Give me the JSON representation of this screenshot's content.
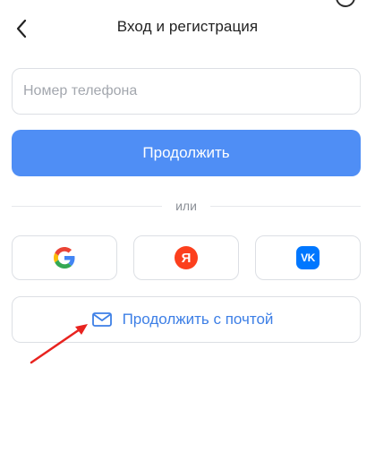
{
  "header": {
    "title": "Вход и регистрация",
    "back_icon": "chevron-left-icon"
  },
  "phone": {
    "placeholder": "Номер телефона",
    "value": ""
  },
  "continue": {
    "label": "Продолжить",
    "color": "#4f8ef5"
  },
  "divider": {
    "label": "или"
  },
  "social": {
    "google_icon": "google-icon",
    "yandex_letter": "Я",
    "yandex_color": "#fc3f1d",
    "vk_letters": "VK",
    "vk_color": "#0077ff"
  },
  "email": {
    "label": "Продолжить с почтой",
    "icon": "envelope-icon",
    "color": "#3d7fe6"
  },
  "annotation": {
    "arrow_color": "#e8231f"
  }
}
